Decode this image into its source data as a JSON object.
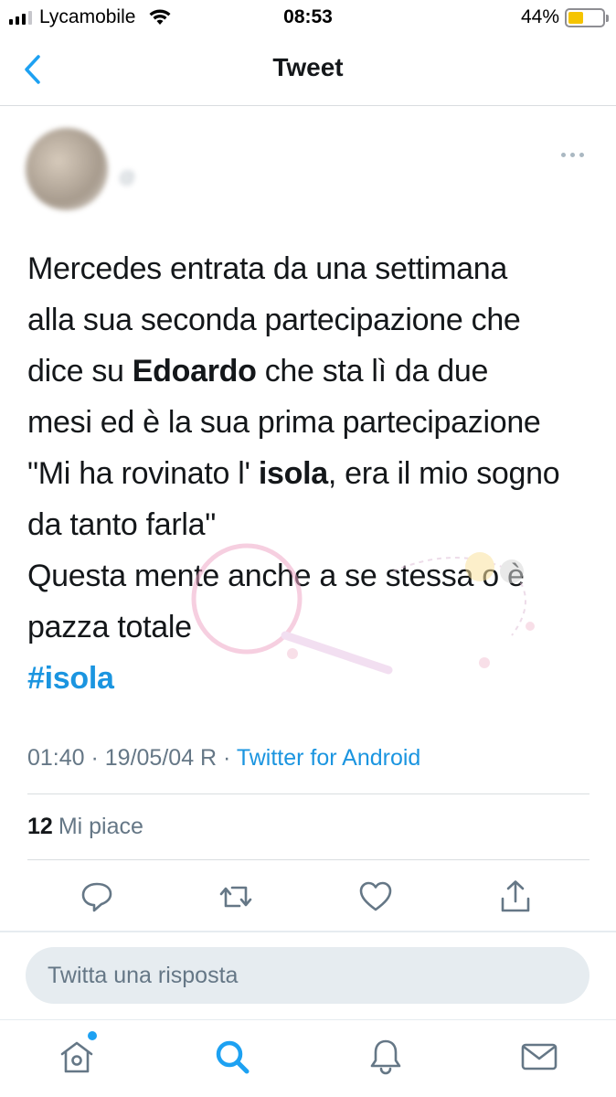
{
  "status_bar": {
    "carrier": "Lycamobile",
    "time": "08:53",
    "battery_percent": "44%",
    "battery_level": 0.44,
    "battery_color": "#f5c400"
  },
  "navbar": {
    "title": "Tweet",
    "back_icon": "chevron-left-icon"
  },
  "tweet": {
    "author": {
      "display_name": "",
      "handle": "@"
    },
    "text_lines": [
      [
        "Mercedes entrata da una settimana"
      ],
      [
        "alla sua seconda partecipazione che"
      ],
      [
        "dice su ",
        "Edoardo",
        " che sta lì da due"
      ],
      [
        "mesi ed è la sua prima partecipazione"
      ],
      [
        "\"Mi ha rovinato l' ",
        "isola",
        ", era il mio sogno"
      ],
      [
        "da tanto farla\""
      ],
      [
        "Questa mente anche a se stessa o è"
      ],
      [
        "pazza totale"
      ]
    ],
    "hashtag": "#isola",
    "timestamp": "01:40 · 19/05/04 R · ",
    "source": "Twitter for Android",
    "likes_count": "12",
    "likes_label": "Mi piace"
  },
  "actions": [
    {
      "name": "reply-button",
      "icon": "speech-bubble-icon"
    },
    {
      "name": "retweet-button",
      "icon": "retweet-arrows-icon"
    },
    {
      "name": "like-button",
      "icon": "heart-icon"
    },
    {
      "name": "share-button",
      "icon": "share-upload-icon"
    }
  ],
  "reply_box": {
    "placeholder": "Twitta una risposta"
  },
  "tabbar": [
    {
      "name": "tab-home",
      "icon": "home-icon",
      "has_notification_dot": true
    },
    {
      "name": "tab-search",
      "icon": "search-icon",
      "active": true
    },
    {
      "name": "tab-notifications",
      "icon": "bell-icon"
    },
    {
      "name": "tab-messages",
      "icon": "envelope-icon"
    }
  ],
  "colors": {
    "accent": "#1b95e0",
    "text": "#14171a",
    "secondary_text": "#657786",
    "divider": "#d9dde0"
  }
}
